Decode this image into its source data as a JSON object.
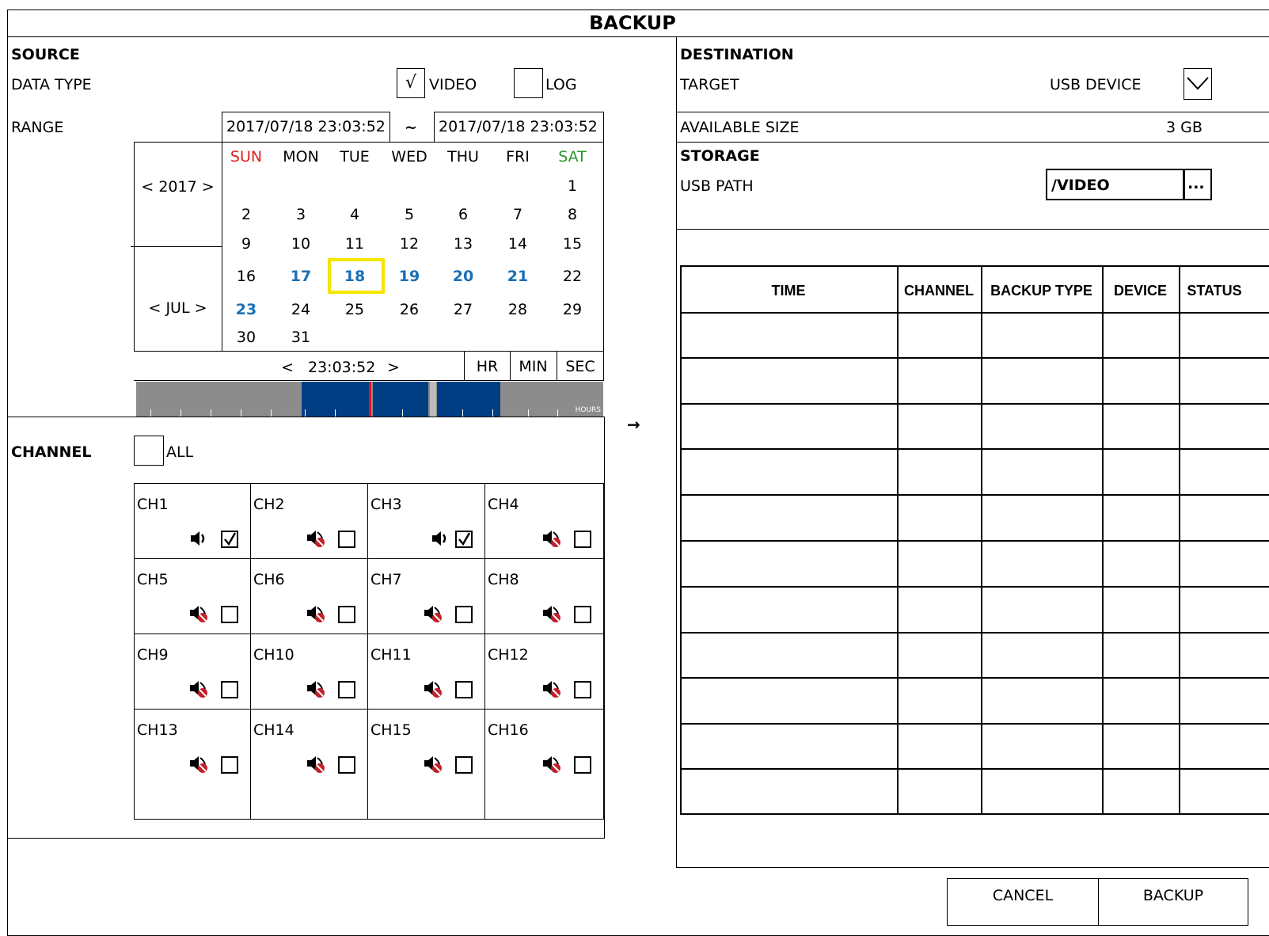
{
  "title": "BACKUP",
  "source": {
    "heading": "SOURCE",
    "data_type_label": "DATA TYPE",
    "video_label": "VIDEO",
    "video_checked": "√",
    "log_label": "LOG",
    "range_label": "RANGE",
    "range_start": "2017/07/18 23:03:52",
    "range_sep": "~",
    "range_end": "2017/07/18 23:03:52"
  },
  "calendar": {
    "year": "< 2017 >",
    "month": "< JUL >",
    "weekdays": [
      "SUN",
      "MON",
      "TUE",
      "WED",
      "THU",
      "FRI",
      "SAT"
    ],
    "weeks": [
      [
        "",
        "",
        "",
        "",
        "",
        "",
        "1"
      ],
      [
        "2",
        "3",
        "4",
        "5",
        "6",
        "7",
        "8"
      ],
      [
        "9",
        "10",
        "11",
        "12",
        "13",
        "14",
        "15"
      ],
      [
        "16",
        "17",
        "18",
        "19",
        "20",
        "21",
        "22"
      ],
      [
        "23",
        "24",
        "25",
        "26",
        "27",
        "28",
        "29"
      ],
      [
        "30",
        "31",
        "",
        "",
        "",
        "",
        ""
      ]
    ],
    "highlighted_days": [
      "17",
      "18",
      "19",
      "20",
      "21",
      "23"
    ],
    "selected_day": "18",
    "colors": {
      "sunday": "#e02020",
      "saturday": "#2a9a2a",
      "highlight": "#1a6fb7",
      "selected_border": "#f5e600"
    }
  },
  "time": {
    "prev": "<",
    "value": "23:03:52",
    "next": ">",
    "hr": "HR",
    "min": "MIN",
    "sec": "SEC"
  },
  "timeline": {
    "units": "HOURS",
    "colors": {
      "empty": "#8c8c8c",
      "recorded": "#003e84",
      "cursor": "#e0141e"
    }
  },
  "arrow": "→",
  "channel": {
    "heading": "CHANNEL",
    "all_label": "ALL",
    "channels": [
      {
        "name": "CH1",
        "audio": "on",
        "checked": "☑"
      },
      {
        "name": "CH2",
        "audio": "off",
        "checked": ""
      },
      {
        "name": "CH3",
        "audio": "on",
        "checked": "☑"
      },
      {
        "name": "CH4",
        "audio": "off",
        "checked": ""
      },
      {
        "name": "CH5",
        "audio": "off",
        "checked": ""
      },
      {
        "name": "CH6",
        "audio": "off",
        "checked": ""
      },
      {
        "name": "CH7",
        "audio": "off",
        "checked": ""
      },
      {
        "name": "CH8",
        "audio": "off",
        "checked": ""
      },
      {
        "name": "CH9",
        "audio": "off",
        "checked": ""
      },
      {
        "name": "CH10",
        "audio": "off",
        "checked": ""
      },
      {
        "name": "CH11",
        "audio": "off",
        "checked": ""
      },
      {
        "name": "CH12",
        "audio": "off",
        "checked": ""
      },
      {
        "name": "CH13",
        "audio": "off",
        "checked": ""
      },
      {
        "name": "CH14",
        "audio": "off",
        "checked": ""
      },
      {
        "name": "CH15",
        "audio": "off",
        "checked": ""
      },
      {
        "name": "CH16",
        "audio": "off",
        "checked": ""
      }
    ]
  },
  "destination": {
    "heading": "DESTINATION",
    "target_label": "TARGET",
    "target_value": "USB DEVICE",
    "available_label": "AVAILABLE SIZE",
    "available_value": "3 GB"
  },
  "storage": {
    "heading": "STORAGE",
    "usb_path_label": "USB PATH",
    "usb_path_value": "/VIDEO",
    "browse_label": "..."
  },
  "table": {
    "headers": [
      "TIME",
      "CHANNEL",
      "BACKUP TYPE",
      "DEVICE",
      "STATUS"
    ]
  },
  "buttons": {
    "cancel": "CANCEL",
    "backup": "BACKUP"
  }
}
